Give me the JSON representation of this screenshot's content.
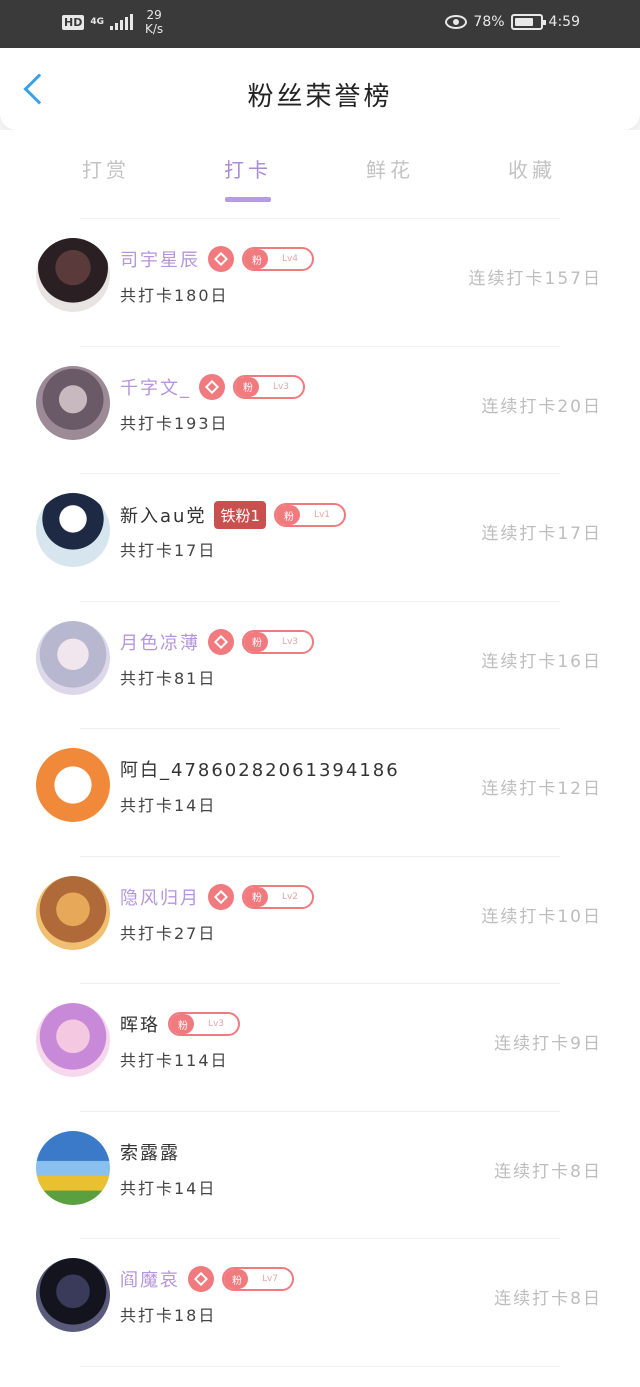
{
  "status_bar": {
    "network_hd": "HD",
    "network_gen": "4G",
    "speed_value": "29",
    "speed_unit": "K/s",
    "battery": "78%",
    "time": "4:59"
  },
  "header": {
    "title": "粉丝荣誉榜"
  },
  "tabs": [
    {
      "label": "打赏"
    },
    {
      "label": "打卡"
    },
    {
      "label": "鲜花"
    },
    {
      "label": "收藏"
    }
  ],
  "active_tab": "打卡",
  "colors": {
    "accent_purple": "#a98bd6",
    "fan_badge": "#f07a7e",
    "iron_badge": "#c8514f",
    "back_arrow": "#3aa0e8"
  },
  "rows": [
    {
      "name": "司宇星辰",
      "name_color": "#b595dd",
      "gem": true,
      "iron": "",
      "level": "Lv4",
      "total": "共打卡180日",
      "streak": "连续打卡157日"
    },
    {
      "name": "千字文_",
      "name_color": "#b595dd",
      "gem": true,
      "iron": "",
      "level": "Lv3",
      "total": "共打卡193日",
      "streak": "连续打卡20日"
    },
    {
      "name": "新入au党",
      "name_color": "#333333",
      "gem": false,
      "iron": "铁粉1",
      "level": "Lv1",
      "total": "共打卡17日",
      "streak": "连续打卡17日"
    },
    {
      "name": "月色凉薄",
      "name_color": "#b595dd",
      "gem": true,
      "iron": "",
      "level": "Lv3",
      "total": "共打卡81日",
      "streak": "连续打卡16日"
    },
    {
      "name": "阿白_4786028206139418​6",
      "name_color": "#333333",
      "gem": false,
      "iron": "",
      "level": "",
      "total": "共打卡14日",
      "streak": "连续打卡12日"
    },
    {
      "name": "隐风归月",
      "name_color": "#b595dd",
      "gem": true,
      "iron": "",
      "level": "Lv2",
      "total": "共打卡27日",
      "streak": "连续打卡10日"
    },
    {
      "name": "晖珞",
      "name_color": "#333333",
      "gem": false,
      "iron": "",
      "level": "Lv3",
      "total": "共打卡114日",
      "streak": "连续打卡9日"
    },
    {
      "name": "索露露",
      "name_color": "#333333",
      "gem": false,
      "iron": "",
      "level": "",
      "total": "共打卡14日",
      "streak": "连续打卡8日"
    },
    {
      "name": "阎魔哀",
      "name_color": "#b595dd",
      "gem": true,
      "iron": "",
      "level": "Lv7",
      "total": "共打卡18日",
      "streak": "连续打卡8日"
    }
  ],
  "fan_label": "粉"
}
